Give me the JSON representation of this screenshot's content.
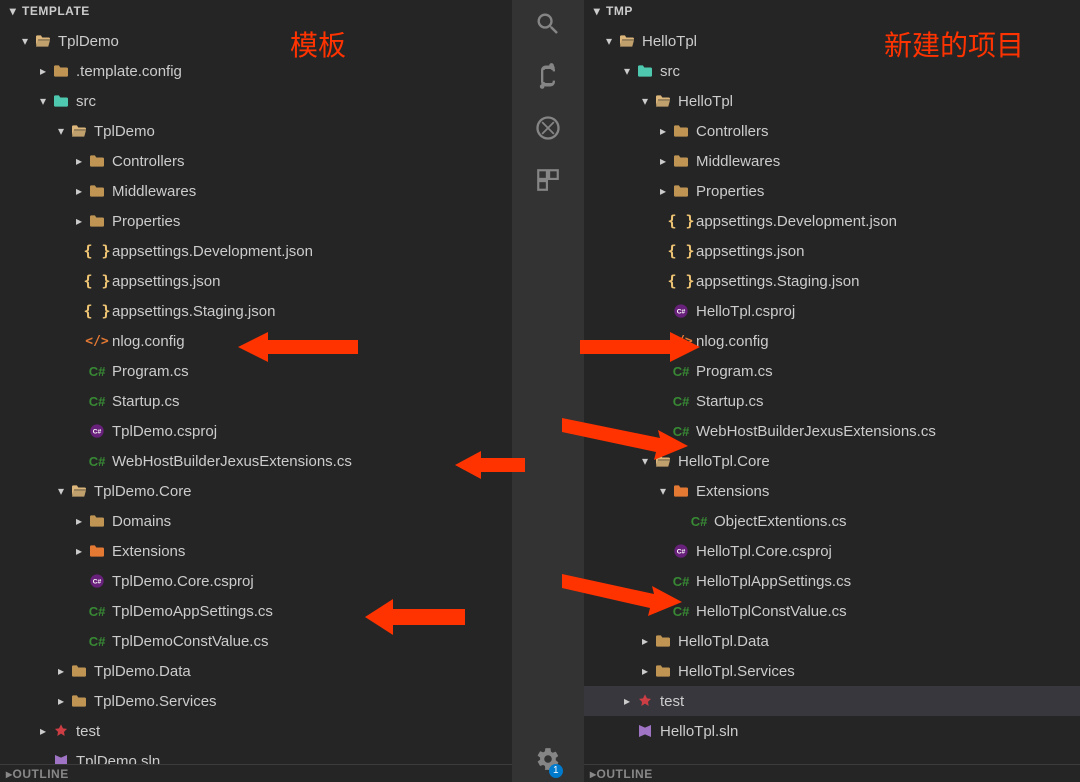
{
  "leftPanel": {
    "header": "TEMPLATE",
    "annotation": "模板",
    "outline": "OUTLINE",
    "tree": [
      {
        "indent": 1,
        "twisty": "down",
        "icon": "folder-open",
        "label": "TplDemo"
      },
      {
        "indent": 2,
        "twisty": "right",
        "icon": "folder",
        "label": ".template.config"
      },
      {
        "indent": 2,
        "twisty": "down",
        "icon": "src",
        "label": "src"
      },
      {
        "indent": 3,
        "twisty": "down",
        "icon": "folder-open",
        "label": "TplDemo"
      },
      {
        "indent": 4,
        "twisty": "right",
        "icon": "folder",
        "label": "Controllers"
      },
      {
        "indent": 4,
        "twisty": "right",
        "icon": "folder",
        "label": "Middlewares"
      },
      {
        "indent": 4,
        "twisty": "right",
        "icon": "folder",
        "label": "Properties"
      },
      {
        "indent": 4,
        "twisty": "",
        "icon": "braces",
        "label": "appsettings.Development.json"
      },
      {
        "indent": 4,
        "twisty": "",
        "icon": "braces",
        "label": "appsettings.json"
      },
      {
        "indent": 4,
        "twisty": "",
        "icon": "braces",
        "label": "appsettings.Staging.json"
      },
      {
        "indent": 4,
        "twisty": "",
        "icon": "codexml",
        "label": "nlog.config"
      },
      {
        "indent": 4,
        "twisty": "",
        "icon": "cs",
        "label": "Program.cs"
      },
      {
        "indent": 4,
        "twisty": "",
        "icon": "cs",
        "label": "Startup.cs"
      },
      {
        "indent": 4,
        "twisty": "",
        "icon": "csproj",
        "label": "TplDemo.csproj"
      },
      {
        "indent": 4,
        "twisty": "",
        "icon": "cs",
        "label": "WebHostBuilderJexusExtensions.cs"
      },
      {
        "indent": 3,
        "twisty": "down",
        "icon": "folder-open",
        "label": "TplDemo.Core"
      },
      {
        "indent": 4,
        "twisty": "right",
        "icon": "folder",
        "label": "Domains"
      },
      {
        "indent": 4,
        "twisty": "right",
        "icon": "ext",
        "label": "Extensions"
      },
      {
        "indent": 4,
        "twisty": "",
        "icon": "csproj",
        "label": "TplDemo.Core.csproj"
      },
      {
        "indent": 4,
        "twisty": "",
        "icon": "cs",
        "label": "TplDemoAppSettings.cs"
      },
      {
        "indent": 4,
        "twisty": "",
        "icon": "cs",
        "label": "TplDemoConstValue.cs"
      },
      {
        "indent": 3,
        "twisty": "right",
        "icon": "folder",
        "label": "TplDemo.Data"
      },
      {
        "indent": 3,
        "twisty": "right",
        "icon": "folder",
        "label": "TplDemo.Services"
      },
      {
        "indent": 2,
        "twisty": "right",
        "icon": "red",
        "label": "test"
      },
      {
        "indent": 2,
        "twisty": "",
        "icon": "sln",
        "label": "TplDemo.sln"
      }
    ]
  },
  "rightPanel": {
    "header": "TMP",
    "annotation": "新建的项目",
    "outline": "OUTLINE",
    "tree": [
      {
        "indent": 1,
        "twisty": "down",
        "icon": "folder-open",
        "label": "HelloTpl"
      },
      {
        "indent": 2,
        "twisty": "down",
        "icon": "src",
        "label": "src"
      },
      {
        "indent": 3,
        "twisty": "down",
        "icon": "folder-open",
        "label": "HelloTpl"
      },
      {
        "indent": 4,
        "twisty": "right",
        "icon": "folder",
        "label": "Controllers"
      },
      {
        "indent": 4,
        "twisty": "right",
        "icon": "folder",
        "label": "Middlewares"
      },
      {
        "indent": 4,
        "twisty": "right",
        "icon": "folder",
        "label": "Properties"
      },
      {
        "indent": 4,
        "twisty": "",
        "icon": "braces",
        "label": "appsettings.Development.json"
      },
      {
        "indent": 4,
        "twisty": "",
        "icon": "braces",
        "label": "appsettings.json"
      },
      {
        "indent": 4,
        "twisty": "",
        "icon": "braces",
        "label": "appsettings.Staging.json"
      },
      {
        "indent": 4,
        "twisty": "",
        "icon": "csproj",
        "label": "HelloTpl.csproj"
      },
      {
        "indent": 4,
        "twisty": "",
        "icon": "codexml",
        "label": "nlog.config"
      },
      {
        "indent": 4,
        "twisty": "",
        "icon": "cs",
        "label": "Program.cs"
      },
      {
        "indent": 4,
        "twisty": "",
        "icon": "cs",
        "label": "Startup.cs"
      },
      {
        "indent": 4,
        "twisty": "",
        "icon": "cs",
        "label": "WebHostBuilderJexusExtensions.cs"
      },
      {
        "indent": 3,
        "twisty": "down",
        "icon": "folder-open",
        "label": "HelloTpl.Core"
      },
      {
        "indent": 4,
        "twisty": "down",
        "icon": "ext",
        "label": "Extensions"
      },
      {
        "indent": 5,
        "twisty": "",
        "icon": "cs",
        "label": "ObjectExtentions.cs"
      },
      {
        "indent": 4,
        "twisty": "",
        "icon": "csproj",
        "label": "HelloTpl.Core.csproj"
      },
      {
        "indent": 4,
        "twisty": "",
        "icon": "cs",
        "label": "HelloTplAppSettings.cs"
      },
      {
        "indent": 4,
        "twisty": "",
        "icon": "cs",
        "label": "HelloTplConstValue.cs"
      },
      {
        "indent": 3,
        "twisty": "right",
        "icon": "folder",
        "label": "HelloTpl.Data"
      },
      {
        "indent": 3,
        "twisty": "right",
        "icon": "folder",
        "label": "HelloTpl.Services"
      },
      {
        "indent": 2,
        "twisty": "right",
        "icon": "red",
        "label": "test",
        "selected": true
      },
      {
        "indent": 2,
        "twisty": "",
        "icon": "sln",
        "label": "HelloTpl.sln"
      }
    ]
  },
  "activityBar": {
    "badge": "1"
  }
}
